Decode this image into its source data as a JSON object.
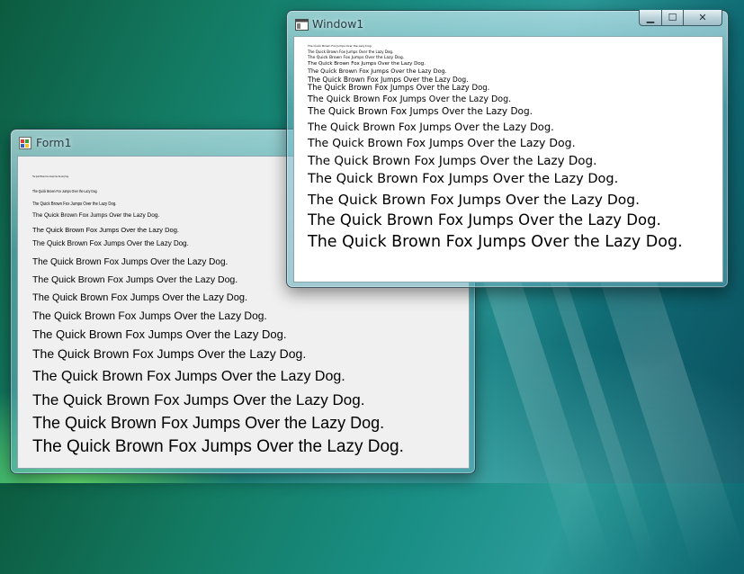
{
  "form1": {
    "title": "Form1",
    "lines": [
      "The Quick Brown Fox Jumps Over the Lazy Dog.",
      "The Quick Brown Fox Jumps Over the Lazy Dog.",
      "The Quick Brown Fox Jumps Over the Lazy Dog.",
      "The Quick Brown Fox Jumps Over the Lazy Dog.",
      "The Quick Brown Fox Jumps Over the Lazy Dog.",
      "The Quick Brown Fox Jumps Over the Lazy Dog.",
      "The Quick Brown Fox Jumps Over the Lazy Dog.",
      "The Quick Brown Fox Jumps Over the Lazy Dog.",
      "The Quick Brown Fox Jumps Over the Lazy Dog.",
      "The Quick Brown Fox Jumps Over the Lazy Dog.",
      "The Quick Brown Fox Jumps Over the Lazy Dog.",
      "The Quick Brown Fox Jumps Over the Lazy Dog.",
      "The Quick Brown Fox Jumps Over the Lazy Dog.",
      "The Quick Brown Fox Jumps Over the Lazy Dog.",
      "The Quick Brown Fox Jumps Over the Lazy Dog.",
      "The Quick Brown Fox Jumps Over the Lazy Dog."
    ]
  },
  "window1": {
    "title": "Window1",
    "lines": [
      "The Quick Brown Fox Jumps Over the Lazy Dog.",
      "The Quick Brown Fox Jumps Over the Lazy Dog.",
      "The Quick Brown Fox Jumps Over the Lazy Dog.",
      "The Quick Brown Fox Jumps Over the Lazy Dog.",
      "The Quick Brown Fox Jumps Over the Lazy Dog.",
      "The Quick Brown Fox Jumps Over the Lazy Dog.",
      "The Quick Brown Fox Jumps Over the Lazy Dog.",
      "The Quick Brown Fox Jumps Over the Lazy Dog.",
      "The Quick Brown Fox Jumps Over the Lazy Dog.",
      "The Quick Brown Fox Jumps Over the Lazy Dog.",
      "The Quick Brown Fox Jumps Over the Lazy Dog.",
      "The Quick Brown Fox Jumps Over the Lazy Dog.",
      "The Quick Brown Fox Jumps Over the Lazy Dog.",
      "The Quick Brown Fox Jumps Over the Lazy Dog.",
      "The Quick Brown Fox Jumps Over the Lazy Dog.",
      "The Quick Brown Fox Jumps Over the Lazy Dog."
    ],
    "caption_buttons": {
      "minimize": "▁",
      "maximize": "☐",
      "close": "✕"
    }
  },
  "icons": {
    "form1": "winforms-app-icon",
    "window1": "wpf-window-icon"
  }
}
